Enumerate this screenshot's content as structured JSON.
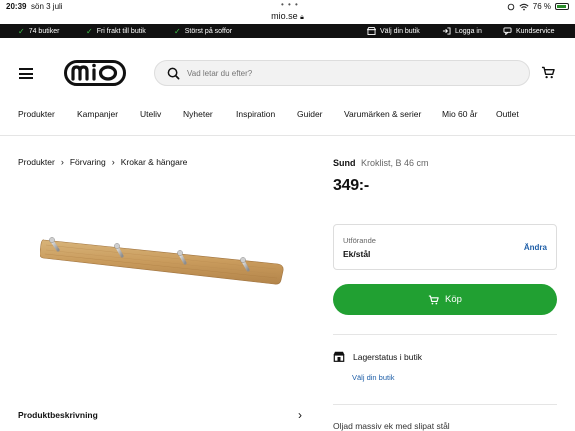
{
  "status": {
    "time": "20:39",
    "date": "sön 3 juli",
    "url": "mio.se",
    "battery": "76 %"
  },
  "usp": [
    {
      "label": "74 butiker"
    },
    {
      "label": "Fri frakt till butik"
    },
    {
      "label": "Störst på soffor"
    }
  ],
  "toplinks": [
    {
      "label": "Välj din butik",
      "icon": "store-icon"
    },
    {
      "label": "Logga in",
      "icon": "login-icon"
    },
    {
      "label": "Kundservice",
      "icon": "chat-icon"
    }
  ],
  "header": {
    "logo": "mio",
    "search_placeholder": "Vad letar du efter?"
  },
  "nav": [
    {
      "label": "Produkter"
    },
    {
      "label": "Kampanjer"
    },
    {
      "label": "Uteliv"
    },
    {
      "label": "Nyheter"
    },
    {
      "label": "Inspiration"
    },
    {
      "label": "Guider"
    },
    {
      "label": "Varumärken & serier"
    },
    {
      "label": "Mio 60 år"
    },
    {
      "label": "Outlet"
    }
  ],
  "breadcrumb": [
    {
      "label": "Produkter"
    },
    {
      "label": "Förvaring"
    },
    {
      "label": "Krokar & hängare"
    }
  ],
  "product": {
    "brand": "Sund",
    "name": "Kroklist, B 46 cm",
    "price": "349:-",
    "variant_label": "Utförande",
    "variant_value": "Ek/stål",
    "change_label": "Ändra",
    "buy_label": "Köp",
    "stock_label": "Lagerstatus i butik",
    "store_link": "Välj din butik",
    "description_label": "Produktbeskrivning",
    "material_text": "Oljad massiv ek med slipat stål"
  },
  "colors": {
    "accent_green": "#21a032",
    "link_blue": "#1f5fa8",
    "top_bar": "#111111"
  }
}
